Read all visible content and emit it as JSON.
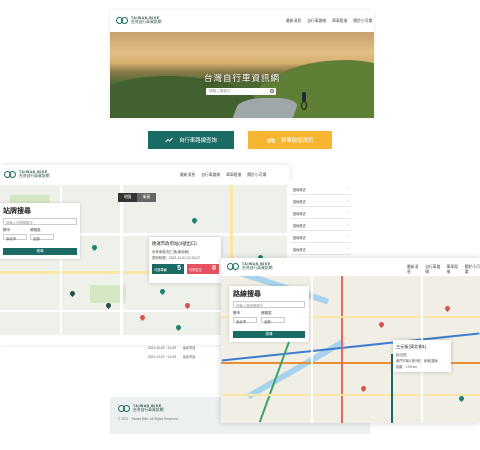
{
  "brand": {
    "name_en": "TAIWAN BIKE",
    "name_zh": "台灣自行車資訊網"
  },
  "nav": [
    "最新消息",
    "自行車路線",
    "單車租借",
    "關於小可樂"
  ],
  "hero": {
    "title": "台灣自行車資訊網",
    "search_placeholder": "請輸入關鍵字"
  },
  "features": {
    "route_label": "自行車路線查詢",
    "route_icon": "trend-line-icon",
    "rent_label": "單車租借資訊",
    "rent_icon": "bicycle-icon",
    "route_color": "#1a6b64",
    "rent_color": "#f6b632"
  },
  "station_search": {
    "title": "站牌搜尋",
    "keyword_placeholder": "請輸入站牌關鍵字",
    "city_label": "縣市",
    "district_label": "鄉鎮區",
    "city_value": "臺北市",
    "district_value": "全部",
    "submit_label": "搜尋",
    "map_toggle": [
      "地圖",
      "衛星"
    ],
    "popup": {
      "name": "捷運市政府站(3號出口)",
      "address": "忠孝東路/松仁路(東南側)",
      "updated": "更新時間：2021-11-01 22:31:07",
      "rent_label": "可借車輛",
      "rent_count": "5",
      "return_label": "可停空位",
      "return_count": "0"
    },
    "list_rows": [
      {
        "date": "2021-10-19 ~ 11-09",
        "name": "臺北市自"
      },
      {
        "date": "2021-10-19 ~ 11-09",
        "name": "臺北市自"
      }
    ]
  },
  "route_list": {
    "rows": [
      {
        "label": "路線概述"
      },
      {
        "label": "路線概述"
      },
      {
        "label": "路線概述"
      },
      {
        "label": "路線概述"
      },
      {
        "label": "路線概述"
      },
      {
        "label": "路線概述"
      }
    ]
  },
  "route_search": {
    "title": "路線搜尋",
    "keyword_placeholder": "請輸入路線關鍵字",
    "city_label": "縣市",
    "district_label": "鄉鎮區",
    "city_value": "臺北市",
    "district_value": "全部",
    "submit_label": "搜尋",
    "popup": {
      "title": "三元街(東北側1)",
      "line1": "起/迄點",
      "line2": "南門市場(1號/9號，東側)路線",
      "line3": "距離：1.09 km"
    }
  },
  "footer": {
    "copyright": "© 2021 · Taiwan Bike. All Rights Reserved"
  }
}
